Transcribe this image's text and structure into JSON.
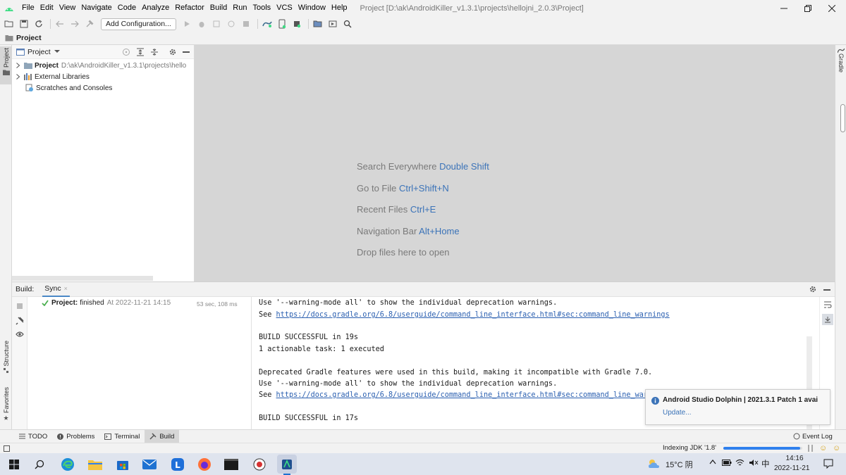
{
  "menu": {
    "items": [
      "File",
      "Edit",
      "View",
      "Navigate",
      "Code",
      "Analyze",
      "Refactor",
      "Build",
      "Run",
      "Tools",
      "VCS",
      "Window",
      "Help"
    ],
    "window_title": "Project [D:\\ak\\AndroidKiller_v1.3.1\\projects\\hellojni_2.0.3\\Project]"
  },
  "toolbar": {
    "add_configuration_label": "Add Configuration..."
  },
  "breadcrumb": {
    "label": "Project"
  },
  "left_stripe": {
    "project_label": "Project",
    "structure_label": "Structure",
    "favorites_label": "Favorites"
  },
  "right_stripe": {
    "gradle_label": "Gradle"
  },
  "project_panel": {
    "view_selector": "Project",
    "tree": [
      {
        "label": "Project",
        "path": "D:\\ak\\AndroidKiller_v1.3.1\\projects\\hello"
      },
      {
        "label": "External Libraries"
      },
      {
        "label": "Scratches and Consoles"
      }
    ]
  },
  "editor_hints": [
    {
      "text": "Search Everywhere ",
      "key": "Double Shift"
    },
    {
      "text": "Go to File ",
      "key": "Ctrl+Shift+N"
    },
    {
      "text": "Recent Files ",
      "key": "Ctrl+E"
    },
    {
      "text": "Navigation Bar ",
      "key": "Alt+Home"
    },
    {
      "text": "Drop files here to open",
      "key": ""
    }
  ],
  "build": {
    "title": "Build:",
    "tab": "Sync",
    "task": {
      "name": "Project:",
      "status": "finished",
      "time": "At 2022-11-21 14:15",
      "duration": "53 sec, 108 ms"
    },
    "console": [
      {
        "text": "Use '--warning-mode all' to show the individual deprecation warnings.",
        "link": ""
      },
      {
        "text": "See ",
        "link": "https://docs.gradle.org/6.8/userguide/command_line_interface.html#sec:command_line_warnings"
      },
      {
        "text": "",
        "link": ""
      },
      {
        "text": "BUILD SUCCESSFUL in 19s",
        "link": ""
      },
      {
        "text": "1 actionable task: 1 executed",
        "link": ""
      },
      {
        "text": "",
        "link": ""
      },
      {
        "text": "Deprecated Gradle features were used in this build, making it incompatible with Gradle 7.0.",
        "link": ""
      },
      {
        "text": "Use '--warning-mode all' to show the individual deprecation warnings.",
        "link": ""
      },
      {
        "text": "See ",
        "link": "https://docs.gradle.org/6.8/userguide/command_line_interface.html#sec:command_line_war"
      },
      {
        "text": "",
        "link": ""
      },
      {
        "text": "BUILD SUCCESSFUL in 17s",
        "link": ""
      }
    ]
  },
  "notification": {
    "title": "Android Studio Dolphin | 2021.3.1 Patch 1 avai",
    "action": "Update..."
  },
  "bottom_tabs": {
    "todo": "TODO",
    "problems": "Problems",
    "terminal": "Terminal",
    "build": "Build",
    "event_log": "Event Log"
  },
  "status": {
    "indexing": "Indexing JDK '1.8'",
    "indexing_progress": 0.97
  },
  "taskbar": {
    "weather": "15°C 阴",
    "ime": "中",
    "time": "14:16",
    "date": "2022-11-21"
  },
  "colors": {
    "accent": "#3b73b8",
    "android_green": "#3ddc84",
    "success_green": "#4caf50",
    "editor_bg": "#d6d6d6",
    "progress_blue": "#2f80ed"
  }
}
